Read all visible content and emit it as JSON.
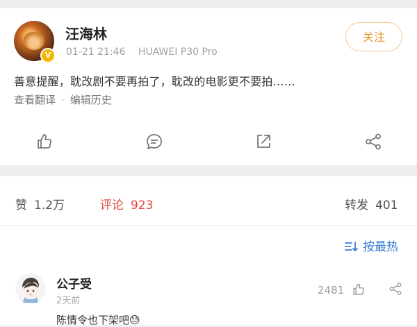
{
  "post": {
    "author": "汪海林",
    "verified_badge": "V",
    "time": "01-21 21:46",
    "device": "HUAWEI P30 Pro",
    "follow_label": "关注",
    "content": "善意提醒，耽改剧不要再拍了，耽改的电影更不要拍……",
    "translate_label": "查看翻译",
    "separator": "·",
    "edit_history_label": "编辑历史"
  },
  "actions": [
    "like-icon",
    "comment-icon",
    "repost-icon",
    "share-icon"
  ],
  "stats": {
    "likes_label": "赞",
    "likes_count": "1.2万",
    "comments_label": "评论",
    "comments_count": "923",
    "reposts_label": "转发",
    "reposts_count": "401"
  },
  "sort": {
    "label": "按最热",
    "icon": "sort-icon"
  },
  "comment": {
    "author": "公子受",
    "time": "2天前",
    "likes": "2481",
    "text": "陈情令也下架吧",
    "emoji": "😓"
  },
  "colors": {
    "accent_orange": "#e8902d",
    "active_red": "#e4463b",
    "link_blue": "#3a7bd5",
    "verified_gold": "#f7b500"
  }
}
